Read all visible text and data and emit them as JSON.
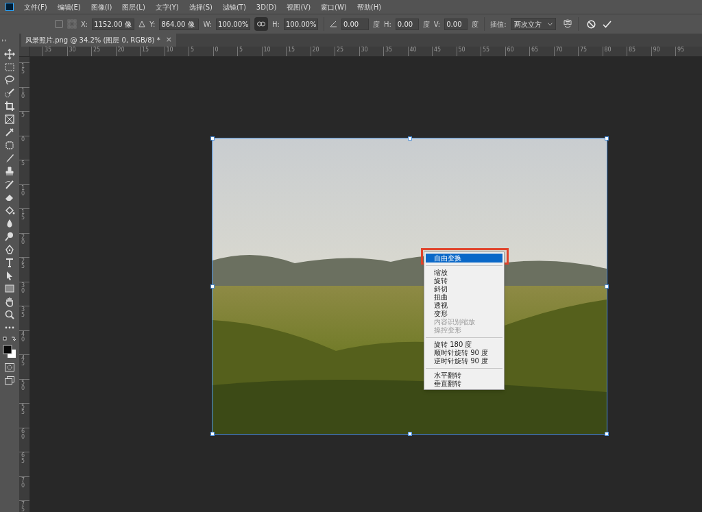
{
  "menu_bar": [
    "文件(F)",
    "编辑(E)",
    "图像(I)",
    "图层(L)",
    "文字(Y)",
    "选择(S)",
    "滤镜(T)",
    "3D(D)",
    "视图(V)",
    "窗口(W)",
    "帮助(H)"
  ],
  "options_bar": {
    "reference_point_checked": false,
    "x": {
      "label": "X:",
      "value": "1152.00 像"
    },
    "y": {
      "label": "Y:",
      "value": "864.00 像"
    },
    "w": {
      "label": "W:",
      "value": "100.00%"
    },
    "link_on": true,
    "h": {
      "label": "H:",
      "value": "100.00%"
    },
    "rotate": {
      "value": "0.00",
      "unit": "度"
    },
    "skew_h": {
      "label": "H:",
      "value": "0.00",
      "unit": "度"
    },
    "skew_v": {
      "label": "V:",
      "value": "0.00",
      "unit": "度"
    },
    "interpolation": {
      "label": "插值:",
      "value": "两次立方"
    }
  },
  "document_tab": {
    "title": "风景照片.png @ 34.2% (图层 0, RGB/8) *",
    "close": "×"
  },
  "rulers": {
    "horizontal": [
      "35",
      "30",
      "25",
      "20",
      "15",
      "10",
      "5",
      "0",
      "5",
      "10",
      "15",
      "20",
      "25",
      "30",
      "35",
      "40",
      "45",
      "50",
      "55",
      "60",
      "65",
      "70",
      "75",
      "80",
      "85",
      "90",
      "95"
    ],
    "vertical": [
      "15",
      "10",
      "5",
      "0",
      "5",
      "10",
      "15",
      "20",
      "25",
      "30",
      "35",
      "40",
      "45",
      "50",
      "55",
      "60",
      "65",
      "70",
      "75"
    ]
  },
  "context_menu": [
    {
      "kind": "item",
      "label": "自由变换",
      "selected": true,
      "disabled": false
    },
    {
      "kind": "separator"
    },
    {
      "kind": "item",
      "label": "缩放",
      "selected": false,
      "disabled": false
    },
    {
      "kind": "item",
      "label": "旋转",
      "selected": false,
      "disabled": false
    },
    {
      "kind": "item",
      "label": "斜切",
      "selected": false,
      "disabled": false
    },
    {
      "kind": "item",
      "label": "扭曲",
      "selected": false,
      "disabled": false
    },
    {
      "kind": "item",
      "label": "透视",
      "selected": false,
      "disabled": false
    },
    {
      "kind": "item",
      "label": "变形",
      "selected": false,
      "disabled": false
    },
    {
      "kind": "item",
      "label": "内容识别缩放",
      "selected": false,
      "disabled": true
    },
    {
      "kind": "item",
      "label": "操控变形",
      "selected": false,
      "disabled": true
    },
    {
      "kind": "separator"
    },
    {
      "kind": "item",
      "label": "旋转 180 度",
      "selected": false,
      "disabled": false
    },
    {
      "kind": "item",
      "label": "顺时针旋转 90 度",
      "selected": false,
      "disabled": false
    },
    {
      "kind": "item",
      "label": "逆时针旋转 90 度",
      "selected": false,
      "disabled": false
    },
    {
      "kind": "separator"
    },
    {
      "kind": "item",
      "label": "水平翻转",
      "selected": false,
      "disabled": false
    },
    {
      "kind": "item",
      "label": "垂直翻转",
      "selected": false,
      "disabled": false
    }
  ]
}
